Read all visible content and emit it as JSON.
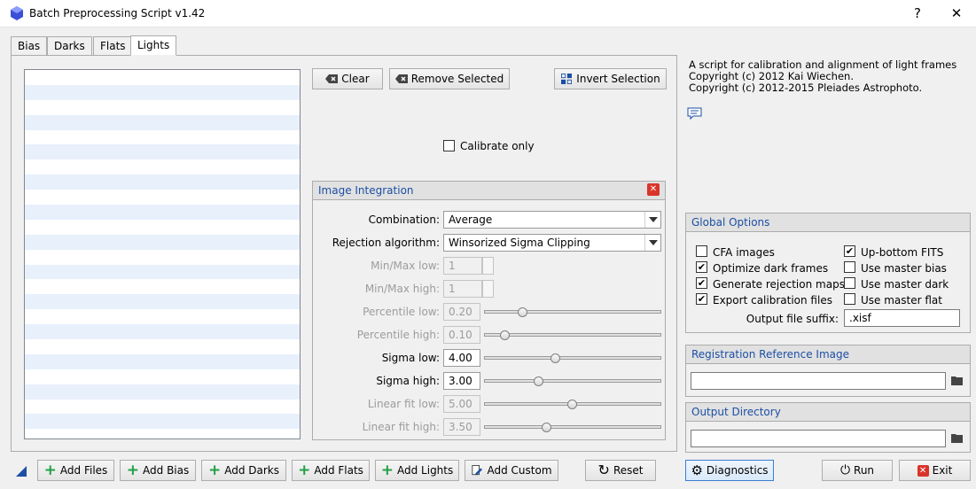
{
  "window": {
    "title": "Batch Preprocessing Script v1.42",
    "help": "?",
    "close": "✕"
  },
  "tabs": [
    "Bias",
    "Darks",
    "Flats",
    "Lights"
  ],
  "toolbar": {
    "clear": "Clear",
    "remove_selected": "Remove Selected",
    "invert_selection": "Invert Selection"
  },
  "calibrate_only": {
    "label": "Calibrate only",
    "checked": false
  },
  "integration": {
    "title": "Image Integration",
    "combination_label": "Combination:",
    "combination_value": "Average",
    "rejection_label": "Rejection algorithm:",
    "rejection_value": "Winsorized Sigma Clipping",
    "minmax_low_label": "Min/Max low:",
    "minmax_low_value": "1",
    "minmax_high_label": "Min/Max high:",
    "minmax_high_value": "1",
    "percentile_low_label": "Percentile low:",
    "percentile_low_value": "0.20",
    "percentile_high_label": "Percentile high:",
    "percentile_high_value": "0.10",
    "sigma_low_label": "Sigma low:",
    "sigma_low_value": "4.00",
    "sigma_high_label": "Sigma high:",
    "sigma_high_value": "3.00",
    "linear_low_label": "Linear fit low:",
    "linear_low_value": "5.00",
    "linear_high_label": "Linear fit high:",
    "linear_high_value": "3.50"
  },
  "info": {
    "line1": "A script for calibration and alignment of light frames",
    "line2": "Copyright (c) 2012 Kai Wiechen.",
    "line3": "Copyright (c) 2012-2015 Pleiades Astrophoto."
  },
  "global_options": {
    "title": "Global Options",
    "cfa_images": "CFA images",
    "up_bottom_fits": "Up-bottom FITS",
    "optimize_dark": "Optimize dark frames",
    "use_master_bias": "Use master bias",
    "gen_rejection": "Generate rejection maps",
    "use_master_dark": "Use master dark",
    "export_calib": "Export calibration files",
    "use_master_flat": "Use master flat",
    "suffix_label": "Output file suffix:",
    "suffix_value": ".xisf"
  },
  "registration": {
    "title": "Registration Reference Image",
    "value": ""
  },
  "output_dir": {
    "title": "Output Directory",
    "value": ""
  },
  "bottom": {
    "add_files": "Add Files",
    "add_bias": "Add Bias",
    "add_darks": "Add Darks",
    "add_flats": "Add Flats",
    "add_lights": "Add Lights",
    "add_custom": "Add Custom",
    "reset": "Reset",
    "diagnostics": "Diagnostics",
    "run": "Run",
    "exit": "Exit"
  },
  "colors": {
    "accent": "#1c4fa5",
    "plus": "#22a045",
    "exit": "#d9342b"
  }
}
